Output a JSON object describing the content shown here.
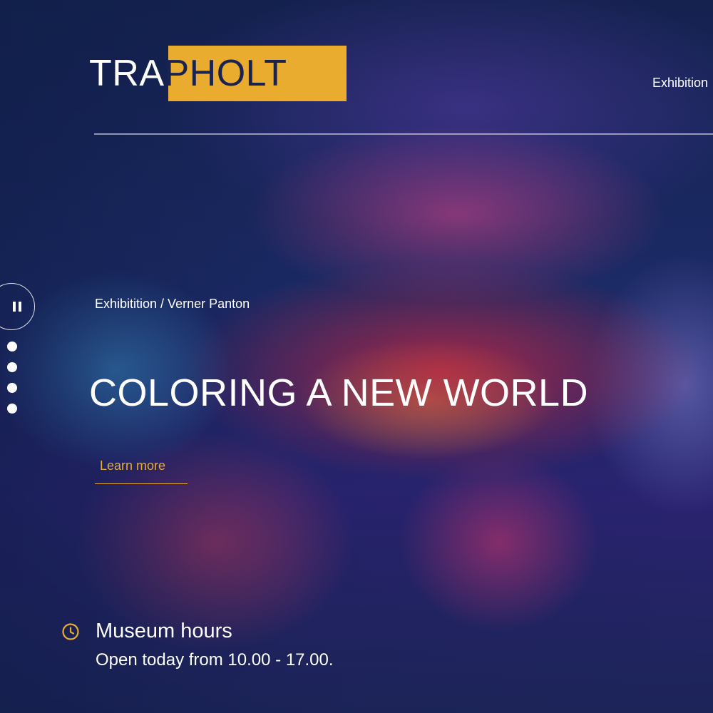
{
  "header": {
    "logo_part1": "TRA",
    "logo_part2": "PHOLT",
    "nav_label": "Exhibition"
  },
  "slideshow": {
    "pause_icon": "pause-icon",
    "dot_count": 4
  },
  "hero": {
    "breadcrumb": "Exhibitition / Verner Panton",
    "title": "COLORING A NEW WORLD",
    "cta_label": "Learn more"
  },
  "info": {
    "icon": "clock-icon",
    "title": "Museum hours",
    "text": "Open today from 10.00 - 17.00."
  },
  "colors": {
    "accent": "#e9ac2f",
    "background": "#16234f"
  }
}
